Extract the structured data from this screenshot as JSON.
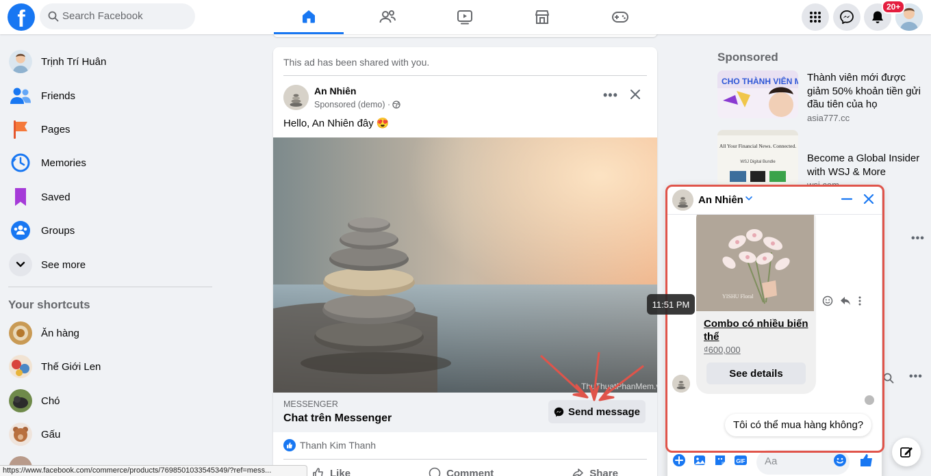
{
  "topbar": {
    "search_placeholder": "Search Facebook",
    "notifications_badge": "20+",
    "nav_tabs": [
      "home",
      "friends",
      "watch",
      "marketplace",
      "gaming"
    ]
  },
  "sidebar": {
    "items": [
      {
        "label": "Trịnh Trí Huân",
        "icon": "profile-avatar"
      },
      {
        "label": "Friends",
        "icon": "friends-icon"
      },
      {
        "label": "Pages",
        "icon": "pages-flag-icon"
      },
      {
        "label": "Memories",
        "icon": "memories-clock-icon"
      },
      {
        "label": "Saved",
        "icon": "saved-bookmark-icon"
      },
      {
        "label": "Groups",
        "icon": "groups-icon"
      },
      {
        "label": "See more",
        "icon": "chevron-down-icon"
      }
    ],
    "shortcuts_title": "Your shortcuts",
    "shortcuts": [
      {
        "label": "Ăn hàng"
      },
      {
        "label": "Thế Giới Len"
      },
      {
        "label": "Chó"
      },
      {
        "label": "Gấu"
      }
    ]
  },
  "post": {
    "shared_note": "This ad has been shared with you.",
    "author": "An Nhiên",
    "sub": "Sponsored (demo) ·",
    "text": "Hello, An Nhiên đây 😍",
    "watermark": "ThuThuatPhanMem.vn",
    "cta_kicker": "MESSENGER",
    "cta_title": "Chat trên Messenger",
    "cta_button": "Send message",
    "reaction_name": "Thanh Kim Thanh",
    "actions": [
      "Like",
      "Comment",
      "Share"
    ]
  },
  "right": {
    "sponsored_title": "Sponsored",
    "ads": [
      {
        "text": "Thành viên mới được giảm 50% khoản tiền gửi đầu tiên của họ",
        "domain": "asia777.cc",
        "banner": "CHO THÀNH VIÊN MỚI"
      },
      {
        "text": "Become a Global Insider with WSJ & More",
        "domain": "wsj.com",
        "banner": "All Your Financial News. Connected.",
        "banner_sub": "WSJ Digital Bundle"
      }
    ]
  },
  "chat": {
    "name": "An Nhiên",
    "product_name": "Combo có nhiều biến thể",
    "product_price": "₫600,000",
    "product_watermark": "YISHU Floral",
    "details_button": "See details",
    "my_message": "Tôi có thể mua hàng không?",
    "input_placeholder": "Aa",
    "timestamp": "11:51 PM"
  },
  "status_url": "https://www.facebook.com/commerce/products/7698501033545349/?ref=mess...",
  "colors": {
    "brand": "#1877f2",
    "page_bg": "#f0f2f5",
    "highlight": "#e0544a",
    "badge": "#e41e3f"
  }
}
